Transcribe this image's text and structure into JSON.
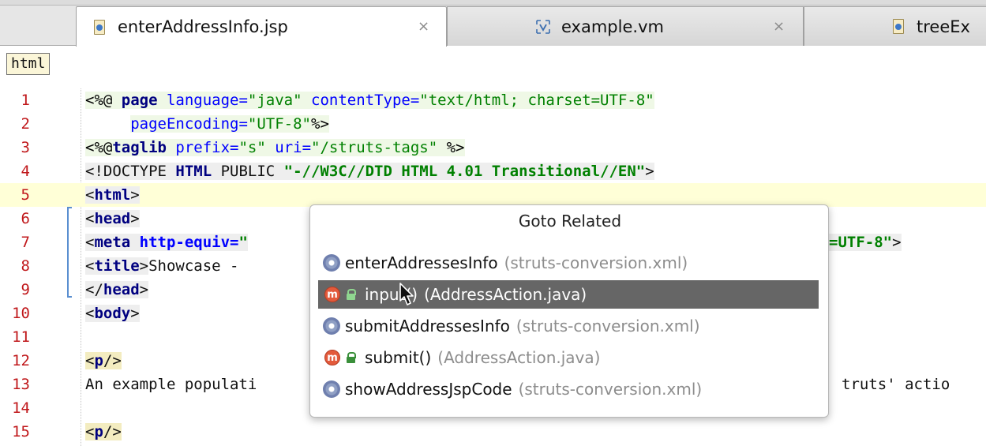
{
  "tabs": [
    {
      "label": "enterAddressInfo.jsp",
      "icon": "jsp-file-icon",
      "active": true,
      "close": "×"
    },
    {
      "label": "example.vm",
      "icon": "velocity-file-icon",
      "active": false,
      "close": "×"
    },
    {
      "label": "treeEx",
      "icon": "jsp-file-icon",
      "active": false
    }
  ],
  "breadcrumb": {
    "item": "html"
  },
  "editor": {
    "caret_line": 5,
    "line_numbers": [
      "1",
      "2",
      "3",
      "4",
      "5",
      "6",
      "7",
      "8",
      "9",
      "10",
      "11",
      "12",
      "13",
      "14",
      "15"
    ],
    "lines": {
      "l1": {
        "open": "<%@ ",
        "page": "page",
        "a1": " language=",
        "v1": "\"java\"",
        "a2": " contentType=",
        "v2": "\"text/html; charset=UTF-8\""
      },
      "l2": {
        "indent": "     ",
        "a1": "pageEncoding=",
        "v1": "\"UTF-8\"",
        "close": "%>"
      },
      "l3": {
        "open": "<%@",
        "taglib": "taglib",
        "a1": " prefix=",
        "v1": "\"s\"",
        "a2": " uri=",
        "v2": "\"/struts-tags\"",
        "close": " %>"
      },
      "l4": {
        "open": "<!DOCTYPE ",
        "html": "HTML",
        "mid": " PUBLIC ",
        "v1": "\"-//W3C//DTD HTML 4.01 Transitional//EN\"",
        "close": ">"
      },
      "l5": {
        "lt": "<",
        "tag": "html",
        "gt": ">"
      },
      "l6": {
        "lt": "<",
        "tag": "head",
        "gt": ">"
      },
      "l7": {
        "lt": "<",
        "tag": "meta",
        "a1": " http-equiv=",
        "q": "\"",
        "v_tail": "=UTF-8\"",
        "gt": ">"
      },
      "l8": {
        "lt": "<",
        "tag": "title",
        "gt": ">",
        "text": "Showcase - "
      },
      "l9": {
        "lt": "</",
        "tag": "head",
        "gt": ">"
      },
      "l10": {
        "lt": "<",
        "tag": "body",
        "gt": ">"
      },
      "l12": {
        "lt": "<",
        "tag": "p",
        "gt": "/>"
      },
      "l13": {
        "text": "An example populati",
        "tail": "truts' actio"
      },
      "l15": {
        "lt": "<",
        "tag": "p",
        "gt": "/>"
      }
    }
  },
  "popup": {
    "title": "Goto Related",
    "items": [
      {
        "name": "enterAddressesInfo",
        "detail": "(struts-conversion.xml)",
        "icon": "gear-icon",
        "selected": false
      },
      {
        "name": "input()",
        "detail": "(AddressAction.java)",
        "icon": "method-icon",
        "lock": true,
        "selected": true
      },
      {
        "name": "submitAddressesInfo",
        "detail": "(struts-conversion.xml)",
        "icon": "gear-icon",
        "selected": false
      },
      {
        "name": "submit()",
        "detail": "(AddressAction.java)",
        "icon": "method-icon",
        "lock": true,
        "selected": false
      },
      {
        "name": "showAddressJspCode",
        "detail": "(struts-conversion.xml)",
        "icon": "gear-icon",
        "selected": false
      }
    ],
    "method_badge": "m"
  }
}
